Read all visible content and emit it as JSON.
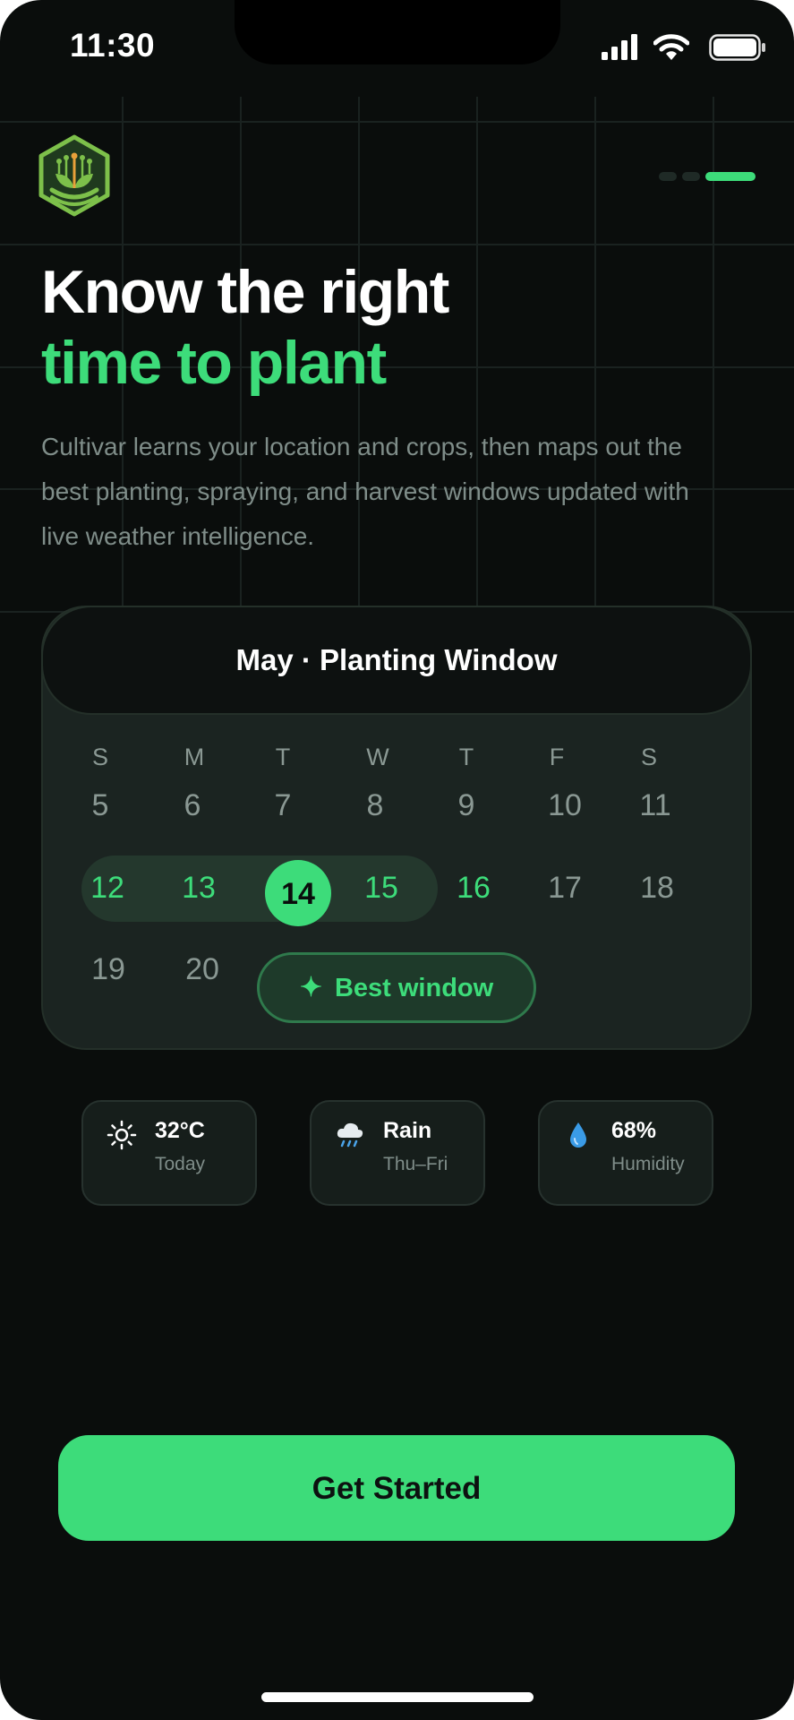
{
  "status_bar": {
    "time": "11:30"
  },
  "header": {
    "pager_active_index": 2,
    "pager_count": 3
  },
  "hero": {
    "title_line1": "Know the right",
    "title_line2": "time to plant",
    "description": "Cultivar learns your location and crops, then maps out the best planting, spraying, and harvest windows updated with live weather intelligence."
  },
  "calendar": {
    "title": "May · Planting Window",
    "weekdays": [
      "S",
      "M",
      "T",
      "W",
      "T",
      "F",
      "S"
    ],
    "week1": [
      "5",
      "6",
      "7",
      "8",
      "9",
      "10",
      "11"
    ],
    "week2": [
      "12",
      "13",
      "14",
      "15",
      "16",
      "17",
      "18"
    ],
    "week3": [
      "19",
      "20"
    ],
    "selected_day": "14",
    "window_days": [
      "12",
      "13",
      "14",
      "15",
      "16"
    ],
    "best_window_label": "Best window"
  },
  "weather": [
    {
      "icon": "sun-icon",
      "value": "32°C",
      "label": "Today"
    },
    {
      "icon": "rain-cloud-icon",
      "value": "Rain",
      "label": "Thu–Fri"
    },
    {
      "icon": "droplet-icon",
      "value": "68%",
      "label": "Humidity"
    }
  ],
  "cta": {
    "label": "Get Started"
  },
  "colors": {
    "accent": "#3ddc7a",
    "background": "#0a0d0c",
    "card": "#1b2421"
  }
}
